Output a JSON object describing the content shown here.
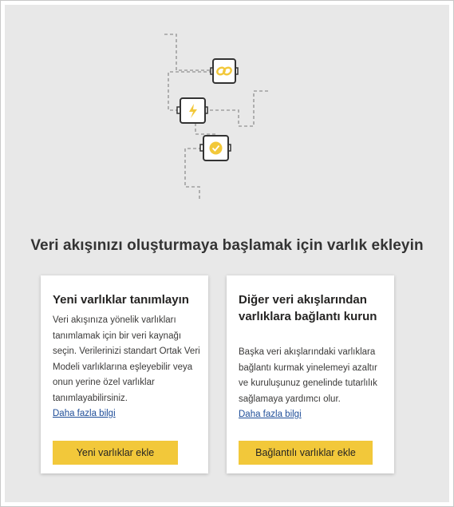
{
  "main": {
    "heading": "Veri akışınızı oluşturmaya başlamak için varlık ekleyin"
  },
  "illustration": {
    "nodes": [
      "link-icon",
      "lightning-icon",
      "checkmark-badge-icon"
    ],
    "accent_color": "#f2c83a",
    "line_color": "#a0a0a0"
  },
  "cards": [
    {
      "title": "Yeni varlıklar tanımlayın",
      "description": "Veri akışınıza yönelik varlıkları tanımlamak için bir veri kaynağı seçin. Verilerinizi standart Ortak Veri Modeli varlıklarına eşleyebilir veya onun yerine özel varlıklar tanımlayabilirsiniz.",
      "link": "Daha fazla bilgi",
      "button": "Yeni varlıklar ekle"
    },
    {
      "title": "Diğer veri akışlarından varlıklara bağlantı kurun",
      "description": "Başka veri akışlarındaki varlıklara bağlantı kurmak yinelemeyi azaltır ve kuruluşunuz genelinde tutarlılık sağlamaya yardımcı olur.",
      "link": "Daha fazla bilgi",
      "button": "Bağlantılı varlıklar ekle"
    }
  ],
  "colors": {
    "button": "#f2c83a",
    "link": "#1f4e99",
    "panel": "#e8e8e8"
  }
}
